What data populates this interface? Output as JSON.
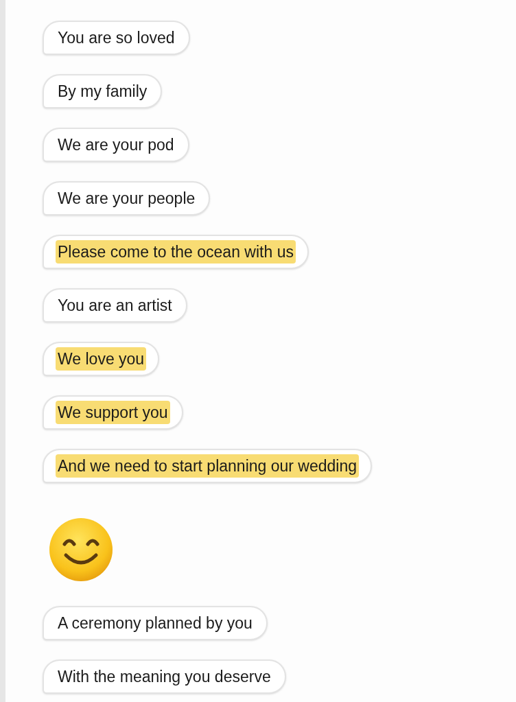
{
  "messages": [
    {
      "kind": "text",
      "text": "You are so loved",
      "highlighted": false
    },
    {
      "kind": "text",
      "text": "By my family",
      "highlighted": false
    },
    {
      "kind": "text",
      "text": "We are your pod",
      "highlighted": false
    },
    {
      "kind": "text",
      "text": "We are your people",
      "highlighted": false
    },
    {
      "kind": "text",
      "text": "Please come to the ocean with us",
      "highlighted": true
    },
    {
      "kind": "text",
      "text": "You are an artist",
      "highlighted": false
    },
    {
      "kind": "text",
      "text": "We love you",
      "highlighted": true
    },
    {
      "kind": "text",
      "text": "We support you",
      "highlighted": true
    },
    {
      "kind": "text",
      "text": "And we need to start planning our wedding",
      "highlighted": true
    },
    {
      "kind": "emoji"
    },
    {
      "kind": "text",
      "text": "A ceremony planned by you",
      "highlighted": false
    },
    {
      "kind": "text",
      "text": "With the meaning you deserve",
      "highlighted": false
    }
  ]
}
